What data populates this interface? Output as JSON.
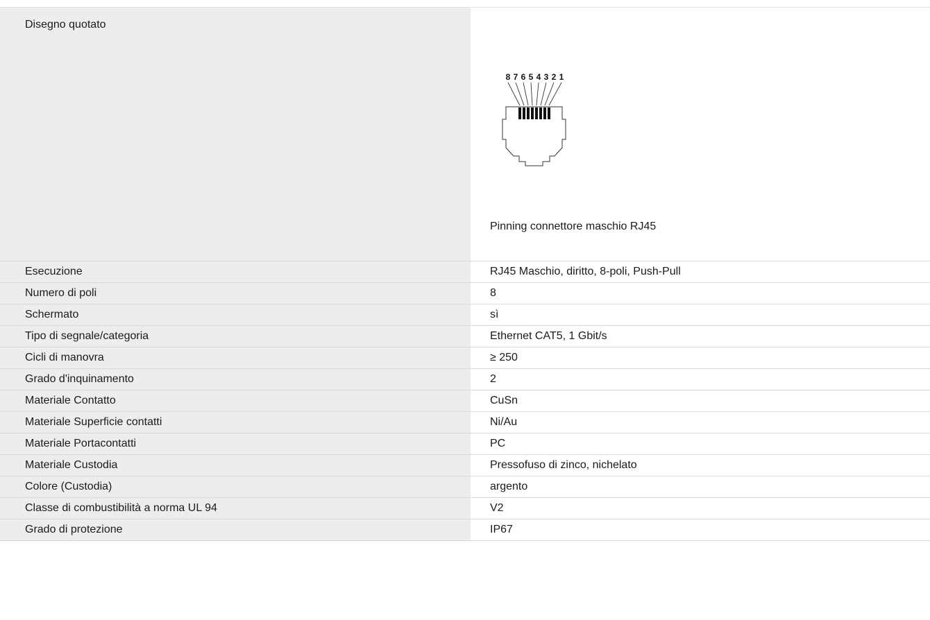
{
  "drawing": {
    "label": "Disegno quotato",
    "pin_numbers": [
      "8",
      "7",
      "6",
      "5",
      "4",
      "3",
      "2",
      "1"
    ],
    "caption": "Pinning connettore maschio RJ45"
  },
  "specs": [
    {
      "label": "Esecuzione",
      "value": "RJ45 Maschio, diritto, 8-poli, Push-Pull"
    },
    {
      "label": "Numero di poli",
      "value": "8"
    },
    {
      "label": "Schermato",
      "value": "sì"
    },
    {
      "label": "Tipo di segnale/categoria",
      "value": "Ethernet CAT5, 1 Gbit/s"
    },
    {
      "label": "Cicli di manovra",
      "value": "≥ 250"
    },
    {
      "label": "Grado d'inquinamento",
      "value": "2"
    },
    {
      "label": "Materiale Contatto",
      "value": "CuSn"
    },
    {
      "label": "Materiale Superficie contatti",
      "value": "Ni/Au"
    },
    {
      "label": "Materiale Portacontatti",
      "value": "PC"
    },
    {
      "label": "Materiale Custodia",
      "value": "Pressofuso di zinco, nichelato"
    },
    {
      "label": "Colore (Custodia)",
      "value": "argento"
    },
    {
      "label": "Classe di combustibilità a norma UL 94",
      "value": "V2"
    },
    {
      "label": "Grado di protezione",
      "value": "IP67"
    }
  ]
}
